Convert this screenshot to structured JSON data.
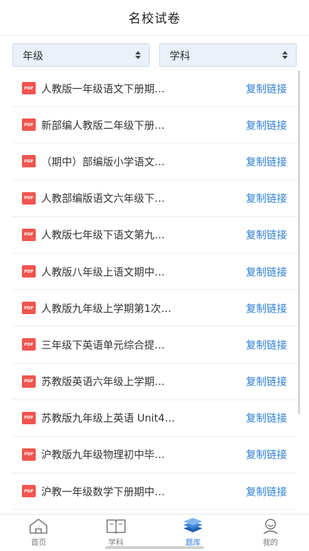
{
  "header": {
    "title": "名校试卷"
  },
  "filters": {
    "grade": {
      "value": "年级"
    },
    "subject": {
      "value": "学科"
    }
  },
  "papers": [
    {
      "name": "人教版一年级语文下册期…",
      "action": "复制链接"
    },
    {
      "name": "新部编人教版二年级下册…",
      "action": "复制链接"
    },
    {
      "name": "（期中）部编版小学语文…",
      "action": "复制链接"
    },
    {
      "name": "人教部编版语文六年级下…",
      "action": "复制链接"
    },
    {
      "name": "人教版七年级下语文第九…",
      "action": "复制链接"
    },
    {
      "name": "人教版八年级上语文期中…",
      "action": "复制链接"
    },
    {
      "name": "人教版九年级上学期第1次…",
      "action": "复制链接"
    },
    {
      "name": "三年级下英语单元综合提…",
      "action": "复制链接"
    },
    {
      "name": "苏教版英语六年级上学期…",
      "action": "复制链接"
    },
    {
      "name": "苏教版九年级上英语 Unit4…",
      "action": "复制链接"
    },
    {
      "name": "沪教版九年级物理初中毕…",
      "action": "复制链接"
    },
    {
      "name": "沪教一年级数学下册期中…",
      "action": "复制链接"
    }
  ],
  "pdf_badge": "PDF",
  "tabbar": {
    "tabs": [
      {
        "label": "首页",
        "icon": "home-icon",
        "active": false
      },
      {
        "label": "学科",
        "icon": "book-icon",
        "active": false
      },
      {
        "label": "题库",
        "icon": "layers-icon",
        "active": true
      },
      {
        "label": "我的",
        "icon": "user-icon",
        "active": false
      }
    ]
  },
  "colors": {
    "accent": "#2f7fd3",
    "pdf": "#f0554e",
    "filter_bg": "#eaf1fa"
  }
}
